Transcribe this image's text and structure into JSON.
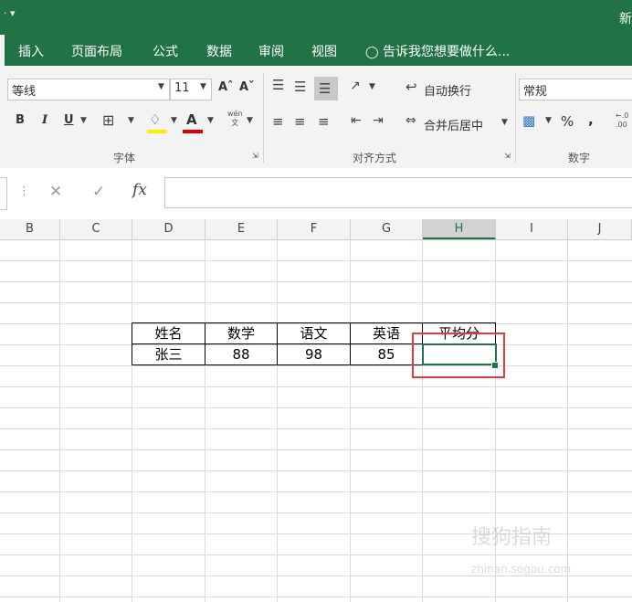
{
  "title_bar": {
    "qat": "·  ▾",
    "title_fragment": "新"
  },
  "tabs": [
    "插入",
    "页面布局",
    "公式",
    "数据",
    "审阅",
    "视图"
  ],
  "tell_me": "告诉我您想要做什么...",
  "font_group": {
    "font_name": "等线",
    "font_size": "11",
    "grow": "Aˆ",
    "shrink": "Aˇ",
    "bold": "B",
    "italic": "I",
    "underline": "U",
    "font_color": "A",
    "phonetic": "wén\n文",
    "label": "字体"
  },
  "align_group": {
    "wrap_text": "自动换行",
    "merge_center": "合并后居中",
    "label": "对齐方式"
  },
  "number_group": {
    "format": "常规",
    "percent": "%",
    "comma": ",",
    "decimal": "←.0\n.00",
    "label": "数字"
  },
  "formula_bar": {
    "cancel": "✕",
    "confirm": "✓",
    "fx": "fx",
    "value": ""
  },
  "columns": [
    "B",
    "C",
    "D",
    "E",
    "F",
    "G",
    "H",
    "I",
    "J"
  ],
  "selected_column": "H",
  "table": {
    "headers": [
      "姓名",
      "数学",
      "语文",
      "英语",
      "平均分"
    ],
    "rows": [
      [
        "张三",
        "88",
        "98",
        "85",
        ""
      ]
    ]
  },
  "watermark": {
    "main": "搜狗指南",
    "sub": "zhinan.sogou.com"
  },
  "colors": {
    "excel_green": "#217346",
    "highlight_red": "#e03c3c"
  }
}
